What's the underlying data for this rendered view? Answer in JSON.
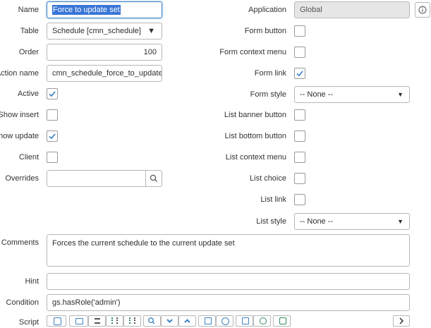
{
  "left": {
    "name": {
      "label": "Name",
      "value": "Force to update set"
    },
    "table": {
      "label": "Table",
      "value": "Schedule [cmn_schedule]"
    },
    "order": {
      "label": "Order",
      "value": "100"
    },
    "action_name": {
      "label": "Action name",
      "value": "cmn_schedule_force_to_update_set"
    },
    "active": {
      "label": "Active",
      "checked": true
    },
    "show_insert": {
      "label": "Show insert",
      "checked": false
    },
    "show_update": {
      "label": "Show update",
      "checked": true
    },
    "client": {
      "label": "Client",
      "checked": false
    },
    "overrides": {
      "label": "Overrides",
      "value": ""
    }
  },
  "right": {
    "application": {
      "label": "Application",
      "value": "Global"
    },
    "form_button": {
      "label": "Form button",
      "checked": false
    },
    "form_context_menu": {
      "label": "Form context menu",
      "checked": false
    },
    "form_link": {
      "label": "Form link",
      "checked": true
    },
    "form_style": {
      "label": "Form style",
      "value": "-- None --"
    },
    "list_banner_button": {
      "label": "List banner button",
      "checked": false
    },
    "list_bottom_button": {
      "label": "List bottom button",
      "checked": false
    },
    "list_context_menu": {
      "label": "List context menu",
      "checked": false
    },
    "list_choice": {
      "label": "List choice",
      "checked": false
    },
    "list_link": {
      "label": "List link",
      "checked": false
    },
    "list_style": {
      "label": "List style",
      "value": "-- None --"
    }
  },
  "bottom": {
    "comments": {
      "label": "Comments",
      "value": "Forces the current schedule to the current update set"
    },
    "hint": {
      "label": "Hint",
      "value": ""
    },
    "condition": {
      "label": "Condition",
      "value": "gs.hasRole('admin')"
    },
    "script": {
      "label": "Script"
    }
  },
  "colors": {
    "accent": "#3b82c4",
    "selection": "#3875d7",
    "readonly_bg": "#e6e6e6",
    "border": "#b7b7b7"
  }
}
